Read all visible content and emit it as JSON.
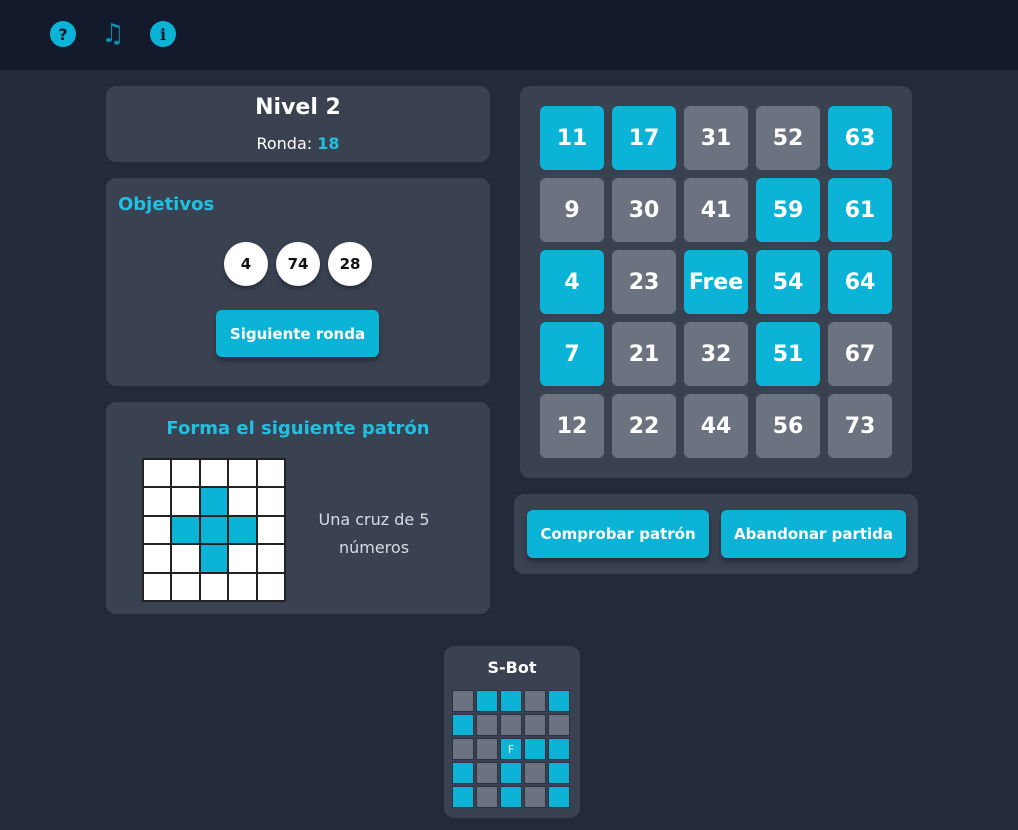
{
  "toolbar": {
    "help_icon": "question-circle-icon",
    "help_glyph": "?",
    "music_icon": "music-note-icon",
    "music_glyph": "♫",
    "info_icon": "info-circle-icon",
    "info_glyph": "i"
  },
  "level": {
    "title": "Nivel 2",
    "round_label": "Ronda:",
    "round_value": "18"
  },
  "objectives": {
    "title": "Objetivos",
    "balls": [
      "4",
      "74",
      "28"
    ],
    "next_button": "Siguiente ronda"
  },
  "pattern": {
    "title": "Forma el siguiente patrón",
    "description": "Una cruz de 5 números",
    "cells": [
      [
        0,
        0,
        0,
        0,
        0
      ],
      [
        0,
        0,
        1,
        0,
        0
      ],
      [
        0,
        1,
        1,
        1,
        0
      ],
      [
        0,
        0,
        1,
        0,
        0
      ],
      [
        0,
        0,
        0,
        0,
        0
      ]
    ]
  },
  "board": {
    "cells": [
      [
        {
          "label": "11",
          "marked": true
        },
        {
          "label": "17",
          "marked": true
        },
        {
          "label": "31",
          "marked": false
        },
        {
          "label": "52",
          "marked": false
        },
        {
          "label": "63",
          "marked": true
        }
      ],
      [
        {
          "label": "9",
          "marked": false
        },
        {
          "label": "30",
          "marked": false
        },
        {
          "label": "41",
          "marked": false
        },
        {
          "label": "59",
          "marked": true
        },
        {
          "label": "61",
          "marked": true
        }
      ],
      [
        {
          "label": "4",
          "marked": true
        },
        {
          "label": "23",
          "marked": false
        },
        {
          "label": "Free",
          "marked": true
        },
        {
          "label": "54",
          "marked": true
        },
        {
          "label": "64",
          "marked": true
        }
      ],
      [
        {
          "label": "7",
          "marked": true
        },
        {
          "label": "21",
          "marked": false
        },
        {
          "label": "32",
          "marked": false
        },
        {
          "label": "51",
          "marked": true
        },
        {
          "label": "67",
          "marked": false
        }
      ],
      [
        {
          "label": "12",
          "marked": false
        },
        {
          "label": "22",
          "marked": false
        },
        {
          "label": "44",
          "marked": false
        },
        {
          "label": "56",
          "marked": false
        },
        {
          "label": "73",
          "marked": false
        }
      ]
    ]
  },
  "actions": {
    "check_button": "Comprobar patrón",
    "quit_button": "Abandonar partida"
  },
  "sbot": {
    "title": "S-Bot",
    "cells": [
      [
        {
          "label": "",
          "marked": false
        },
        {
          "label": "",
          "marked": true
        },
        {
          "label": "",
          "marked": true
        },
        {
          "label": "",
          "marked": false
        },
        {
          "label": "",
          "marked": true
        }
      ],
      [
        {
          "label": "",
          "marked": true
        },
        {
          "label": "",
          "marked": false
        },
        {
          "label": "",
          "marked": false
        },
        {
          "label": "",
          "marked": false
        },
        {
          "label": "",
          "marked": false
        }
      ],
      [
        {
          "label": "",
          "marked": false
        },
        {
          "label": "",
          "marked": false
        },
        {
          "label": "F",
          "marked": true
        },
        {
          "label": "",
          "marked": true
        },
        {
          "label": "",
          "marked": true
        }
      ],
      [
        {
          "label": "",
          "marked": true
        },
        {
          "label": "",
          "marked": false
        },
        {
          "label": "",
          "marked": true
        },
        {
          "label": "",
          "marked": false
        },
        {
          "label": "",
          "marked": true
        }
      ],
      [
        {
          "label": "",
          "marked": true
        },
        {
          "label": "",
          "marked": false
        },
        {
          "label": "",
          "marked": true
        },
        {
          "label": "",
          "marked": false
        },
        {
          "label": "",
          "marked": true
        }
      ]
    ]
  },
  "colors": {
    "accent": "#0bb4d6",
    "unmarked_cell": "#6b7280",
    "panel": "#3a4252",
    "background": "#232a3a",
    "topbar": "#121a2b"
  }
}
